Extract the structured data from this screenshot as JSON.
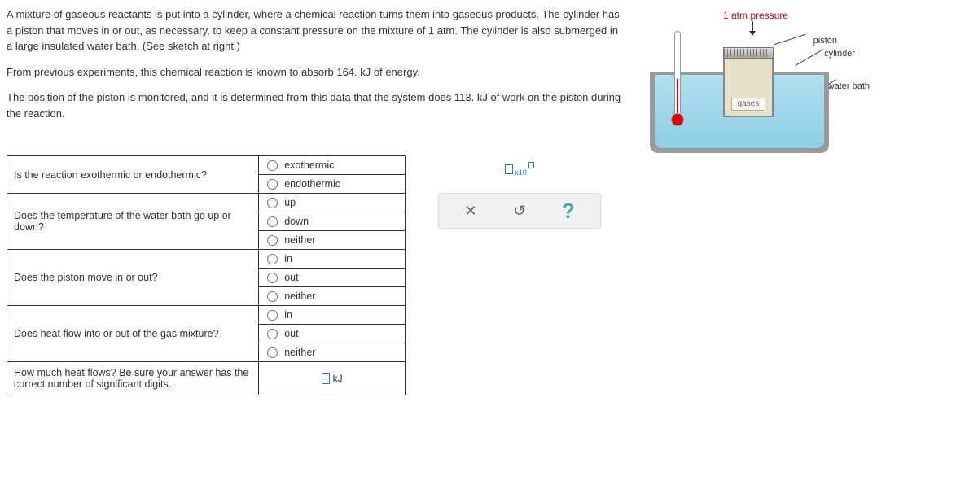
{
  "description": {
    "p1": "A mixture of gaseous reactants is put into a cylinder, where a chemical reaction turns them into gaseous products. The cylinder has a piston that moves in or out, as necessary, to keep a constant pressure on the mixture of 1 atm. The cylinder is also submerged in a large insulated water bath. (See sketch at right.)",
    "p2": "From previous experiments, this chemical reaction is known to absorb 164. kJ of energy.",
    "p3": "The position of the piston is monitored, and it is determined from this data that the system does 113. kJ of work on the piston during the reaction."
  },
  "diagram": {
    "pressure_label": "1 atm pressure",
    "piston_label": "piston",
    "cylinder_label": "cylinder",
    "waterbath_label": "water bath",
    "gases_label": "gases"
  },
  "questions": {
    "q1": {
      "text": "Is the reaction exothermic or endothermic?",
      "opts": [
        "exothermic",
        "endothermic"
      ]
    },
    "q2": {
      "text": "Does the temperature of the water bath go up or down?",
      "opts": [
        "up",
        "down",
        "neither"
      ]
    },
    "q3": {
      "text": "Does the piston move in or out?",
      "opts": [
        "in",
        "out",
        "neither"
      ]
    },
    "q4": {
      "text": "Does heat flow into or out of the gas mixture?",
      "opts": [
        "in",
        "out",
        "neither"
      ]
    },
    "q5": {
      "text": "How much heat flows? Be sure your answer has the correct number of significant digits.",
      "unit": "kJ"
    }
  },
  "palette": {
    "sci_sub": "x10",
    "clear": "✕",
    "reset": "↺",
    "help": "?"
  }
}
